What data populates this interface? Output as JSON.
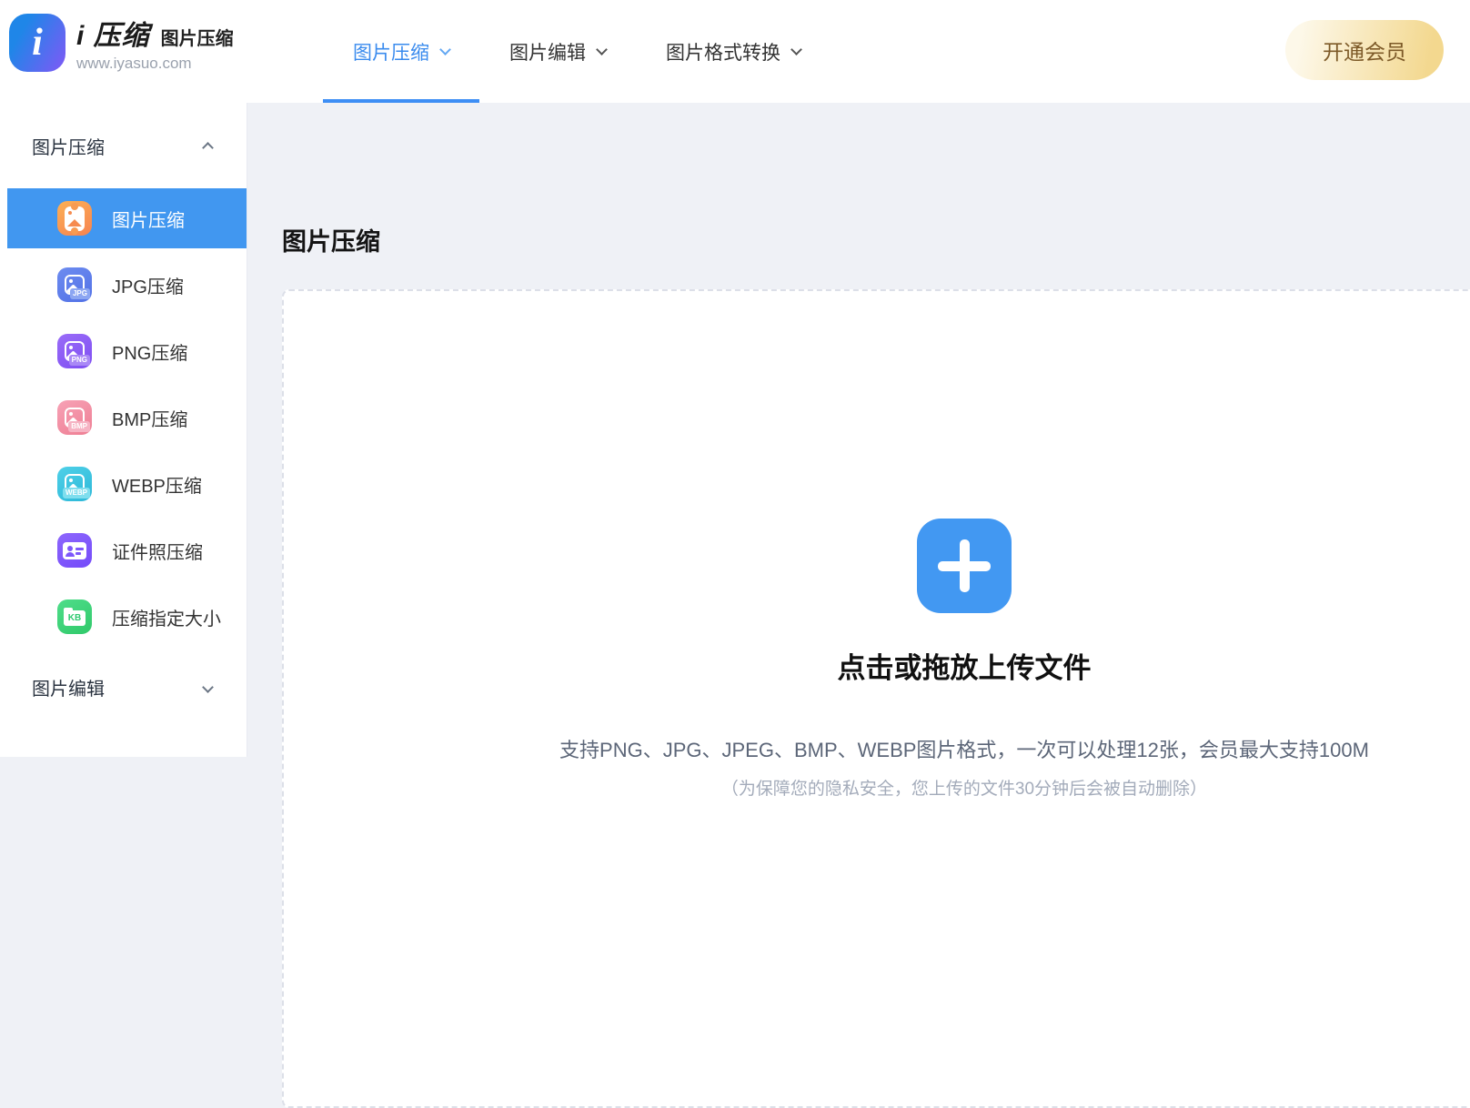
{
  "brand": {
    "logo_glyph": "i",
    "title": "i 压缩",
    "subtitle": "图片压缩",
    "url": "www.iyasuo.com"
  },
  "header": {
    "tabs": [
      {
        "label": "图片压缩",
        "active": true,
        "chevron": "down"
      },
      {
        "label": "图片编辑",
        "active": false,
        "chevron": "down"
      },
      {
        "label": "图片格式转换",
        "active": false,
        "chevron": "down"
      }
    ],
    "vip_label": "开通会员"
  },
  "sidebar": {
    "section_compress": {
      "label": "图片压缩",
      "chevron": "up"
    },
    "section_edit": {
      "label": "图片编辑",
      "chevron": "down"
    },
    "items": [
      {
        "label": "图片压缩",
        "badge": "",
        "active": true
      },
      {
        "label": "JPG压缩",
        "badge": "JPG",
        "active": false
      },
      {
        "label": "PNG压缩",
        "badge": "PNG",
        "active": false
      },
      {
        "label": "BMP压缩",
        "badge": "BMP",
        "active": false
      },
      {
        "label": "WEBP压缩",
        "badge": "WEBP",
        "active": false
      },
      {
        "label": "证件照压缩",
        "badge": "",
        "active": false
      },
      {
        "label": "压缩指定大小",
        "badge": "KB",
        "active": false
      }
    ]
  },
  "main": {
    "title": "图片压缩",
    "upload": {
      "plus_icon": "+",
      "heading": "点击或拖放上传文件",
      "support": "支持PNG、JPG、JPEG、BMP、WEBP图片格式，一次可以处理12张，会员最大支持100M",
      "note": "（为保障您的隐私安全，您上传的文件30分钟后会被自动删除）"
    }
  },
  "colors": {
    "accent_blue": "#3d8ef5",
    "active_item_blue": "#4197f0",
    "upload_plus_blue": "#4298f2",
    "vip_gold_start": "#fdf8e9",
    "vip_gold_end": "#f3d88f",
    "vip_text_brown": "#7d5a28",
    "icon_orange": "#f68350",
    "icon_jpg_blue": "#5271e6",
    "icon_png_purple": "#7e4ef2",
    "icon_bmp_pink": "#ee7e93",
    "icon_webp_cyan": "#2db8d8",
    "icon_id_violet": "#744bfa",
    "icon_kb_green": "#30c96a",
    "main_bg": "#eff1f6"
  }
}
